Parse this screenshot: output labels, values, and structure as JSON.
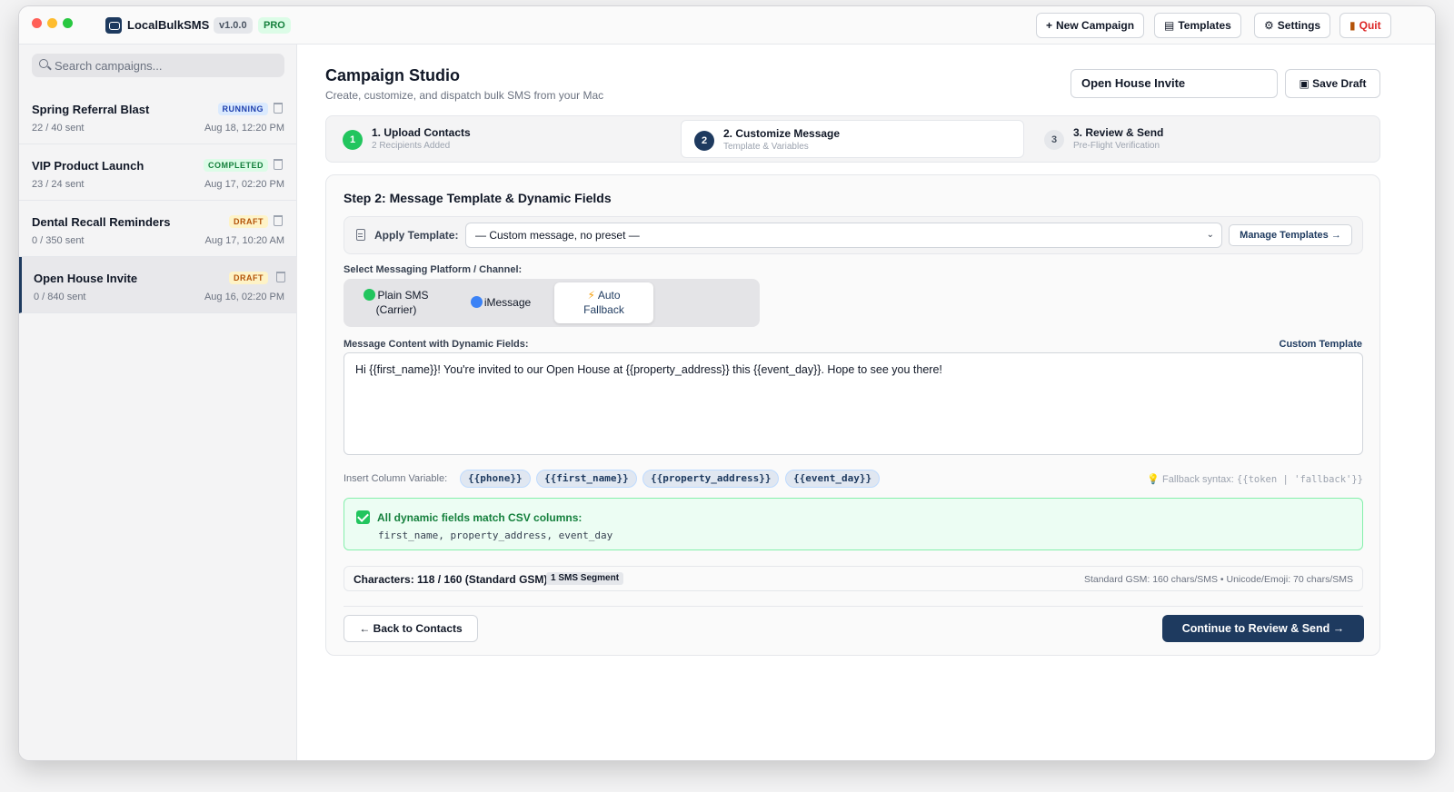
{
  "app": {
    "name": "LocalBulkSMS",
    "version": "v1.0.0",
    "tier": "PRO"
  },
  "toolbar": {
    "new_campaign": "New Campaign",
    "templates": "Templates",
    "settings": "Settings",
    "quit": "Quit"
  },
  "sidebar": {
    "search_placeholder": "Search campaigns...",
    "campaigns": [
      {
        "name": "Spring Referral Blast",
        "status": "RUNNING",
        "sent": "22 / 40 sent",
        "date": "Aug 18, 12:20 PM"
      },
      {
        "name": "VIP Product Launch",
        "status": "COMPLETED",
        "sent": "23 / 24 sent",
        "date": "Aug 17, 02:20 PM"
      },
      {
        "name": "Dental Recall Reminders",
        "status": "DRAFT",
        "sent": "0 / 350 sent",
        "date": "Aug 17, 10:20 AM"
      },
      {
        "name": "Open House Invite",
        "status": "DRAFT",
        "sent": "0 / 840 sent",
        "date": "Aug 16, 02:20 PM"
      }
    ]
  },
  "header": {
    "title": "Campaign Studio",
    "subtitle": "Create, customize, and dispatch bulk SMS from your Mac",
    "campaign_name": "Open House Invite",
    "save_draft": "Save Draft"
  },
  "steps": [
    {
      "num": "1",
      "title": "1. Upload Contacts",
      "subtitle": "2 Recipients Added"
    },
    {
      "num": "2",
      "title": "2. Customize Message",
      "subtitle": "Template & Variables"
    },
    {
      "num": "3",
      "title": "3. Review & Send",
      "subtitle": "Pre-Flight Verification"
    }
  ],
  "editor": {
    "title": "Step 2: Message Template & Dynamic Fields",
    "apply_template_label": "Apply Template:",
    "template_selected": "— Custom message, no preset —",
    "manage_templates": "Manage Templates →",
    "platform_label": "Select Messaging Platform / Channel:",
    "platforms": [
      {
        "line1": "Plain SMS",
        "line2": "(Carrier)"
      },
      {
        "line1": "iMessage"
      },
      {
        "line1": "Auto",
        "line2": "Fallback"
      }
    ],
    "message_label": "Message Content with Dynamic Fields:",
    "custom_template": "Custom Template",
    "message": "Hi {{first_name}}! You're invited to our Open House at {{property_address}} this {{event_day}}. Hope to see you there!",
    "insert_label": "Insert Column Variable:",
    "variables": [
      "{{phone}}",
      "{{first_name}}",
      "{{property_address}}",
      "{{event_day}}"
    ],
    "fallback_prefix": "Fallback syntax:",
    "fallback_syntax": "{{token | 'fallback'}}",
    "match_title": "All dynamic fields match CSV columns:",
    "match_columns": "first_name, property_address, event_day",
    "char_count": "Characters: 118 / 160 (Standard GSM)",
    "segment_badge": "1 SMS Segment",
    "char_info": "Standard GSM: 160 chars/SMS • Unicode/Emoji: 70 chars/SMS",
    "back_button": "← Back to Contacts",
    "continue_button": "Continue to Review & Send →"
  }
}
